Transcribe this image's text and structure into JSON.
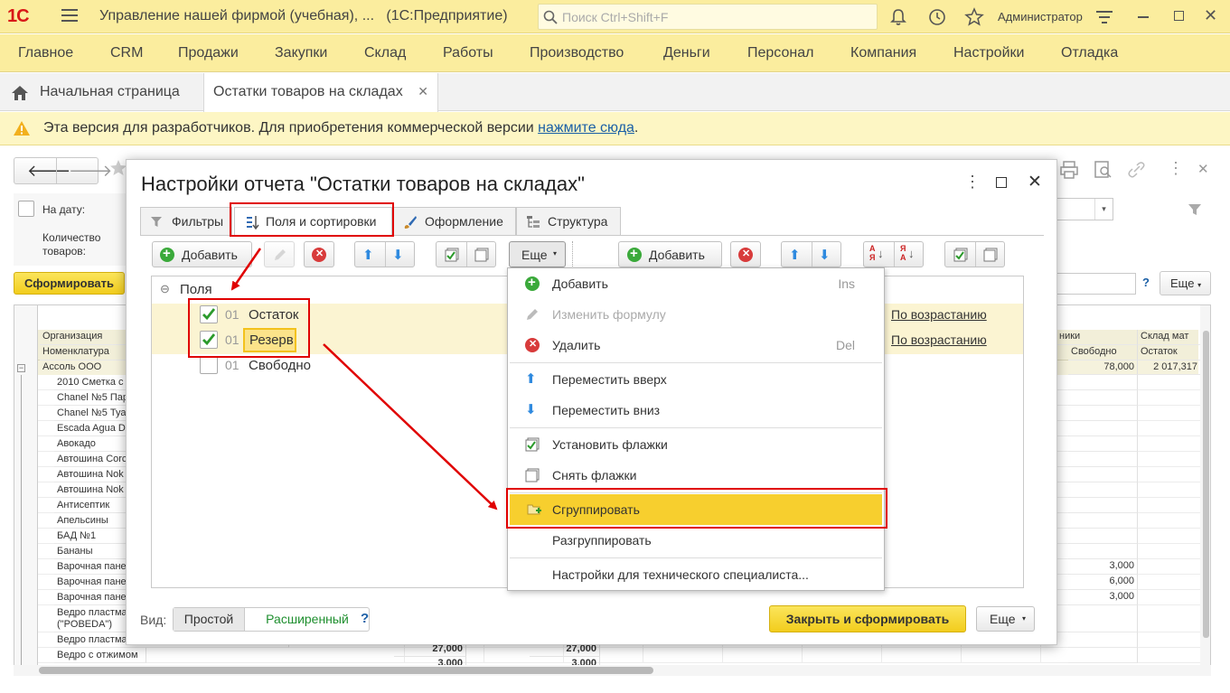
{
  "app": {
    "logo": "1С",
    "title": "Управление нашей фирмой (учебная), ...",
    "subtitle": "(1С:Предприятие)",
    "search_placeholder": "Поиск Ctrl+Shift+F",
    "user": "Администратор"
  },
  "main_menu": [
    "Главное",
    "CRM",
    "Продажи",
    "Закупки",
    "Склад",
    "Работы",
    "Производство",
    "Деньги",
    "Персонал",
    "Компания",
    "Настройки",
    "Отладка"
  ],
  "tabs": {
    "home": "Начальная страница",
    "active": "Остатки товаров на складах",
    "close": "✕"
  },
  "banner": {
    "text": "Эта версия для разработчиков. Для приобретения коммерческой версии",
    "link": "нажмите сюда",
    "end": "."
  },
  "report": {
    "date_label": "На дату:",
    "count_label": "Количество товаров:",
    "form_button": "Сформировать",
    "help": "?",
    "more": "Еще",
    "col_org": "Организация",
    "col_nom": "Номенклатура",
    "col_right1": "ники",
    "col_free": "Свободно",
    "col_store": "Склад мат",
    "col_rest": "Остаток",
    "group_row": "Ассоль ООО",
    "group_free": "78,000",
    "group_rest": "2 017,317",
    "rows": [
      {
        "name": "2010 Сметка с",
        "free": ""
      },
      {
        "name": "Chanel №5 Пар",
        "free": ""
      },
      {
        "name": "Chanel №5 Туа",
        "free": ""
      },
      {
        "name": "Escada Agua D",
        "free": ""
      },
      {
        "name": "Авокадо",
        "free": ""
      },
      {
        "name": "Автошина Corc",
        "free": ""
      },
      {
        "name": "Автошина Nok XL",
        "free": ""
      },
      {
        "name": "Автошина Nok",
        "free": ""
      },
      {
        "name": "Антисептик",
        "free": ""
      },
      {
        "name": "Апельсины",
        "free": ""
      },
      {
        "name": "БАД №1",
        "free": ""
      },
      {
        "name": "Бананы",
        "free": ""
      },
      {
        "name": "Варочная пане",
        "free": "3,000"
      },
      {
        "name": "Варочная пане",
        "free": "6,000"
      },
      {
        "name": "Варочная пане",
        "free": "3,000"
      },
      {
        "name": "Ведро пластма (\"POBEDA\")",
        "free": ""
      },
      {
        "name": "Ведро пластмассовое с крышкой (\"POBEDA\")",
        "free": ""
      },
      {
        "name": "Ведро с отжимом",
        "free": ""
      }
    ],
    "row_val1": "27,000",
    "row_val2": "27,000",
    "row_val3": "3,000",
    "row_val4": "3,000"
  },
  "dialog": {
    "title": "Настройки отчета \"Остатки товаров на складах\"",
    "tabs": [
      "Фильтры",
      "Поля и сортировки",
      "Оформление",
      "Структура"
    ],
    "add": "Добавить",
    "more": "Еще",
    "add2": "Добавить",
    "tree_root": "Поля",
    "fields": [
      {
        "code": "01",
        "name": "Остаток",
        "checked": true
      },
      {
        "code": "01",
        "name": "Резерв",
        "checked": true
      },
      {
        "code": "01",
        "name": "Свободно",
        "checked": false
      }
    ],
    "sort": [
      "По возрастанию",
      "По возрастанию"
    ],
    "view_label": "Вид:",
    "view_simple": "Простой",
    "view_ext": "Расширенный",
    "help": "?",
    "close_form": "Закрыть и сформировать",
    "more2": "Еще"
  },
  "popup": {
    "items": [
      {
        "label": "Добавить",
        "key": "Ins"
      },
      {
        "label": "Изменить формулу",
        "key": ""
      },
      {
        "label": "Удалить",
        "key": "Del"
      },
      {
        "label": "Переместить вверх",
        "key": ""
      },
      {
        "label": "Переместить вниз",
        "key": ""
      },
      {
        "label": "Установить флажки",
        "key": ""
      },
      {
        "label": "Снять флажки",
        "key": ""
      },
      {
        "label": "Сгруппировать",
        "key": ""
      },
      {
        "label": "Разгруппировать",
        "key": ""
      },
      {
        "label": "Настройки для технического специалиста...",
        "key": ""
      }
    ]
  },
  "colors": {
    "accent_yellow": "#fbed9e",
    "highlight": "#f7cf2e",
    "annotation_red": "#e00000",
    "green": "#3aa93a"
  }
}
